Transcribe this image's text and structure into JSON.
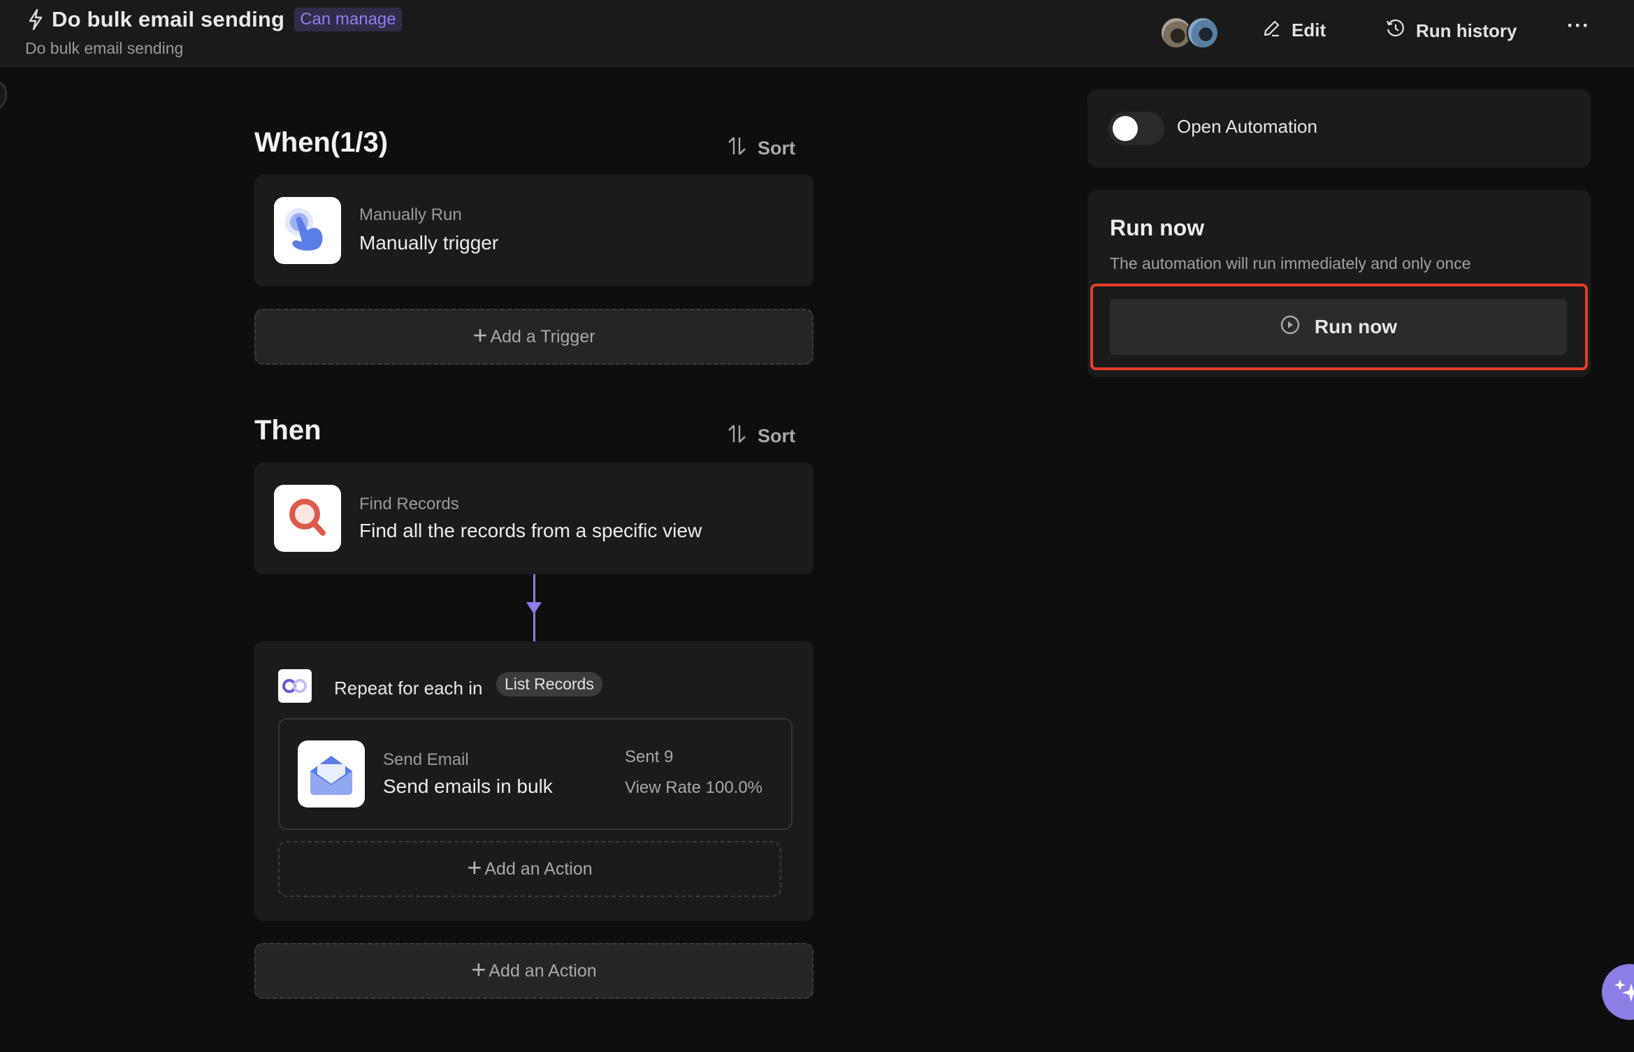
{
  "header": {
    "title": "Do bulk email sending",
    "permission_badge": "Can manage",
    "subtitle": "Do bulk email sending",
    "avatars": [
      "collaborator-1",
      "collaborator-2"
    ],
    "buttons": {
      "edit": "Edit",
      "run_history": "Run history",
      "more": "···"
    }
  },
  "when_section": {
    "title": "When(1/3)",
    "sort_label": "Sort",
    "trigger": {
      "icon": "tap-hand-icon",
      "kind": "Manually Run",
      "description": "Manually trigger"
    },
    "add_trigger_label": "Add a Trigger"
  },
  "then_section": {
    "title": "Then",
    "sort_label": "Sort",
    "find_records": {
      "icon": "magnifier-icon",
      "kind": "Find Records",
      "description": "Find all the records from a specific view"
    },
    "loop": {
      "icon": "loop-icon",
      "label": "Repeat for each in",
      "source_chip": "List Records",
      "action": {
        "icon": "envelope-icon",
        "kind": "Send Email",
        "description": "Send emails in bulk",
        "sent": "Sent 9",
        "view_rate": "View Rate 100.0%"
      },
      "add_action_label": "Add an Action"
    },
    "add_action_label": "Add an Action"
  },
  "right_panel": {
    "open_automation": {
      "label": "Open Automation",
      "enabled": false
    },
    "run_now": {
      "title": "Run now",
      "description": "The automation will run immediately and only once",
      "button_label": "Run now"
    }
  },
  "colors": {
    "accent": "#8b7fe6",
    "highlight": "#e53d2a",
    "badge_text": "#8b7ff0"
  }
}
